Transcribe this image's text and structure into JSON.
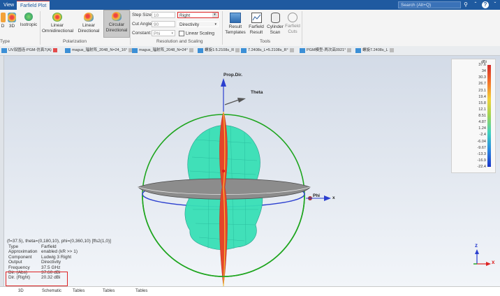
{
  "ribbon_tabs": [
    "View",
    "Farfield Plot"
  ],
  "search_placeholder": "Search (Alt+Q)",
  "ribbon": {
    "plot_type_group": {
      "buttons": [
        "D",
        "3D",
        "Isotropic"
      ],
      "label": "Type"
    },
    "polarization_group": {
      "buttons": [
        "Linear Omnidirectional",
        "Linear Directional",
        "Circular Directional"
      ],
      "label": "Polarization"
    },
    "resolution_group": {
      "step_size_label": "Step Size:",
      "step_size_value": "10",
      "cut_angle_label": "Cut Angle:",
      "cut_angle_value": "90",
      "constant_label": "Constant:",
      "constant_value": "Phi",
      "polarization_select": "Right",
      "output_select": "Directivity",
      "linear_scaling_label": "Linear Scaling",
      "label": "Resolution and Scaling"
    },
    "tools_group": {
      "buttons": [
        "Result Templates",
        "Farfield Result",
        "Cylinder Scan",
        "Farfield Cuts"
      ],
      "label": "Tools"
    }
  },
  "doc_tabs": [
    "UV双圆连-PGM-仿真7(A)",
    "magus_辐射阵_2048_N=24_16°",
    "magus_辐射阵_2048_N=24°",
    "螺旋1:5.2108s_R",
    "7.2408s_L=5.2108s_R°",
    "PGM模型-两次高0921°",
    "螺旋7.2408s_L"
  ],
  "viewport": {
    "prop_dir_label": "Prop.Dir.",
    "theta_label": "Theta",
    "phi_label": "Phi",
    "x_label": "x",
    "axis_z": "z",
    "axis_x": "x"
  },
  "legend": {
    "unit": "dBi",
    "ticks": [
      "37.6",
      "34",
      "30.3",
      "26.7",
      "23.1",
      "19.4",
      "15.8",
      "12.1",
      "8.51",
      "4.87",
      "1.24",
      "-2.4",
      "-6.04",
      "-9.67",
      "-13.3",
      "-16.9",
      "-22.4"
    ]
  },
  "info_panel": {
    "header": "(f=37.5), theta=(0,180,10), phi=(0,360,10) [ffs2(1,0)]",
    "rows": [
      {
        "key": "Type",
        "value": "Farfield"
      },
      {
        "key": "Approximation",
        "value": "enabled (kR >> 1)"
      },
      {
        "key": "Component",
        "value": "Ludwig 3 Right"
      },
      {
        "key": "Output",
        "value": "Directivity"
      },
      {
        "key": "Frequency",
        "value": "37.5 GHz"
      },
      {
        "key": "Dir. (Abs)",
        "value": "37.60 dBi"
      },
      {
        "key": "Dir. (Right)",
        "value": "20.32 dBi"
      }
    ]
  },
  "bottom_tabs": [
    "3D",
    "Schematic",
    "Tables",
    "Tables",
    "Tables"
  ],
  "colors": {
    "accent": "#1f5aa0",
    "highlight_red": "#d22222",
    "mesh": "#35e0b8"
  }
}
